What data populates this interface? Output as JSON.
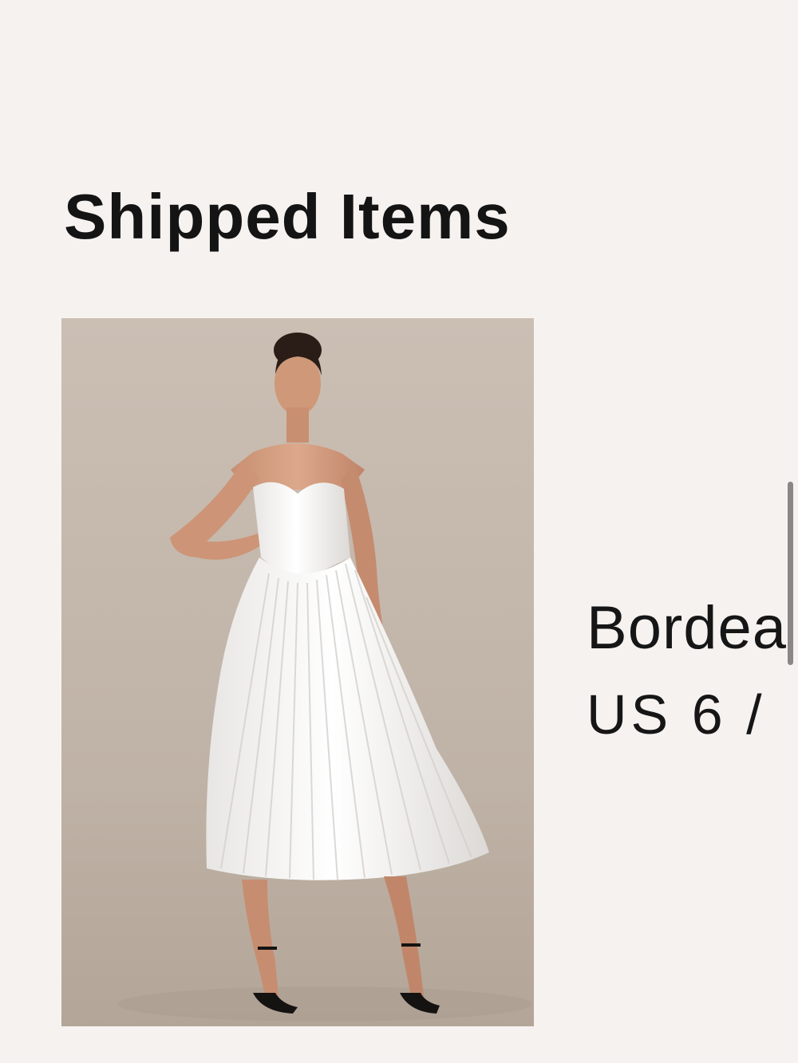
{
  "section": {
    "title": "Shipped Items"
  },
  "item": {
    "image_icon": "white-strapless-pleated-midi-dress-photo",
    "name": "Bordea",
    "variant": "US 6 /"
  },
  "colors": {
    "background": "#f6f2f0",
    "text": "#111111",
    "photo_backdrop": "#c4b8ad"
  }
}
